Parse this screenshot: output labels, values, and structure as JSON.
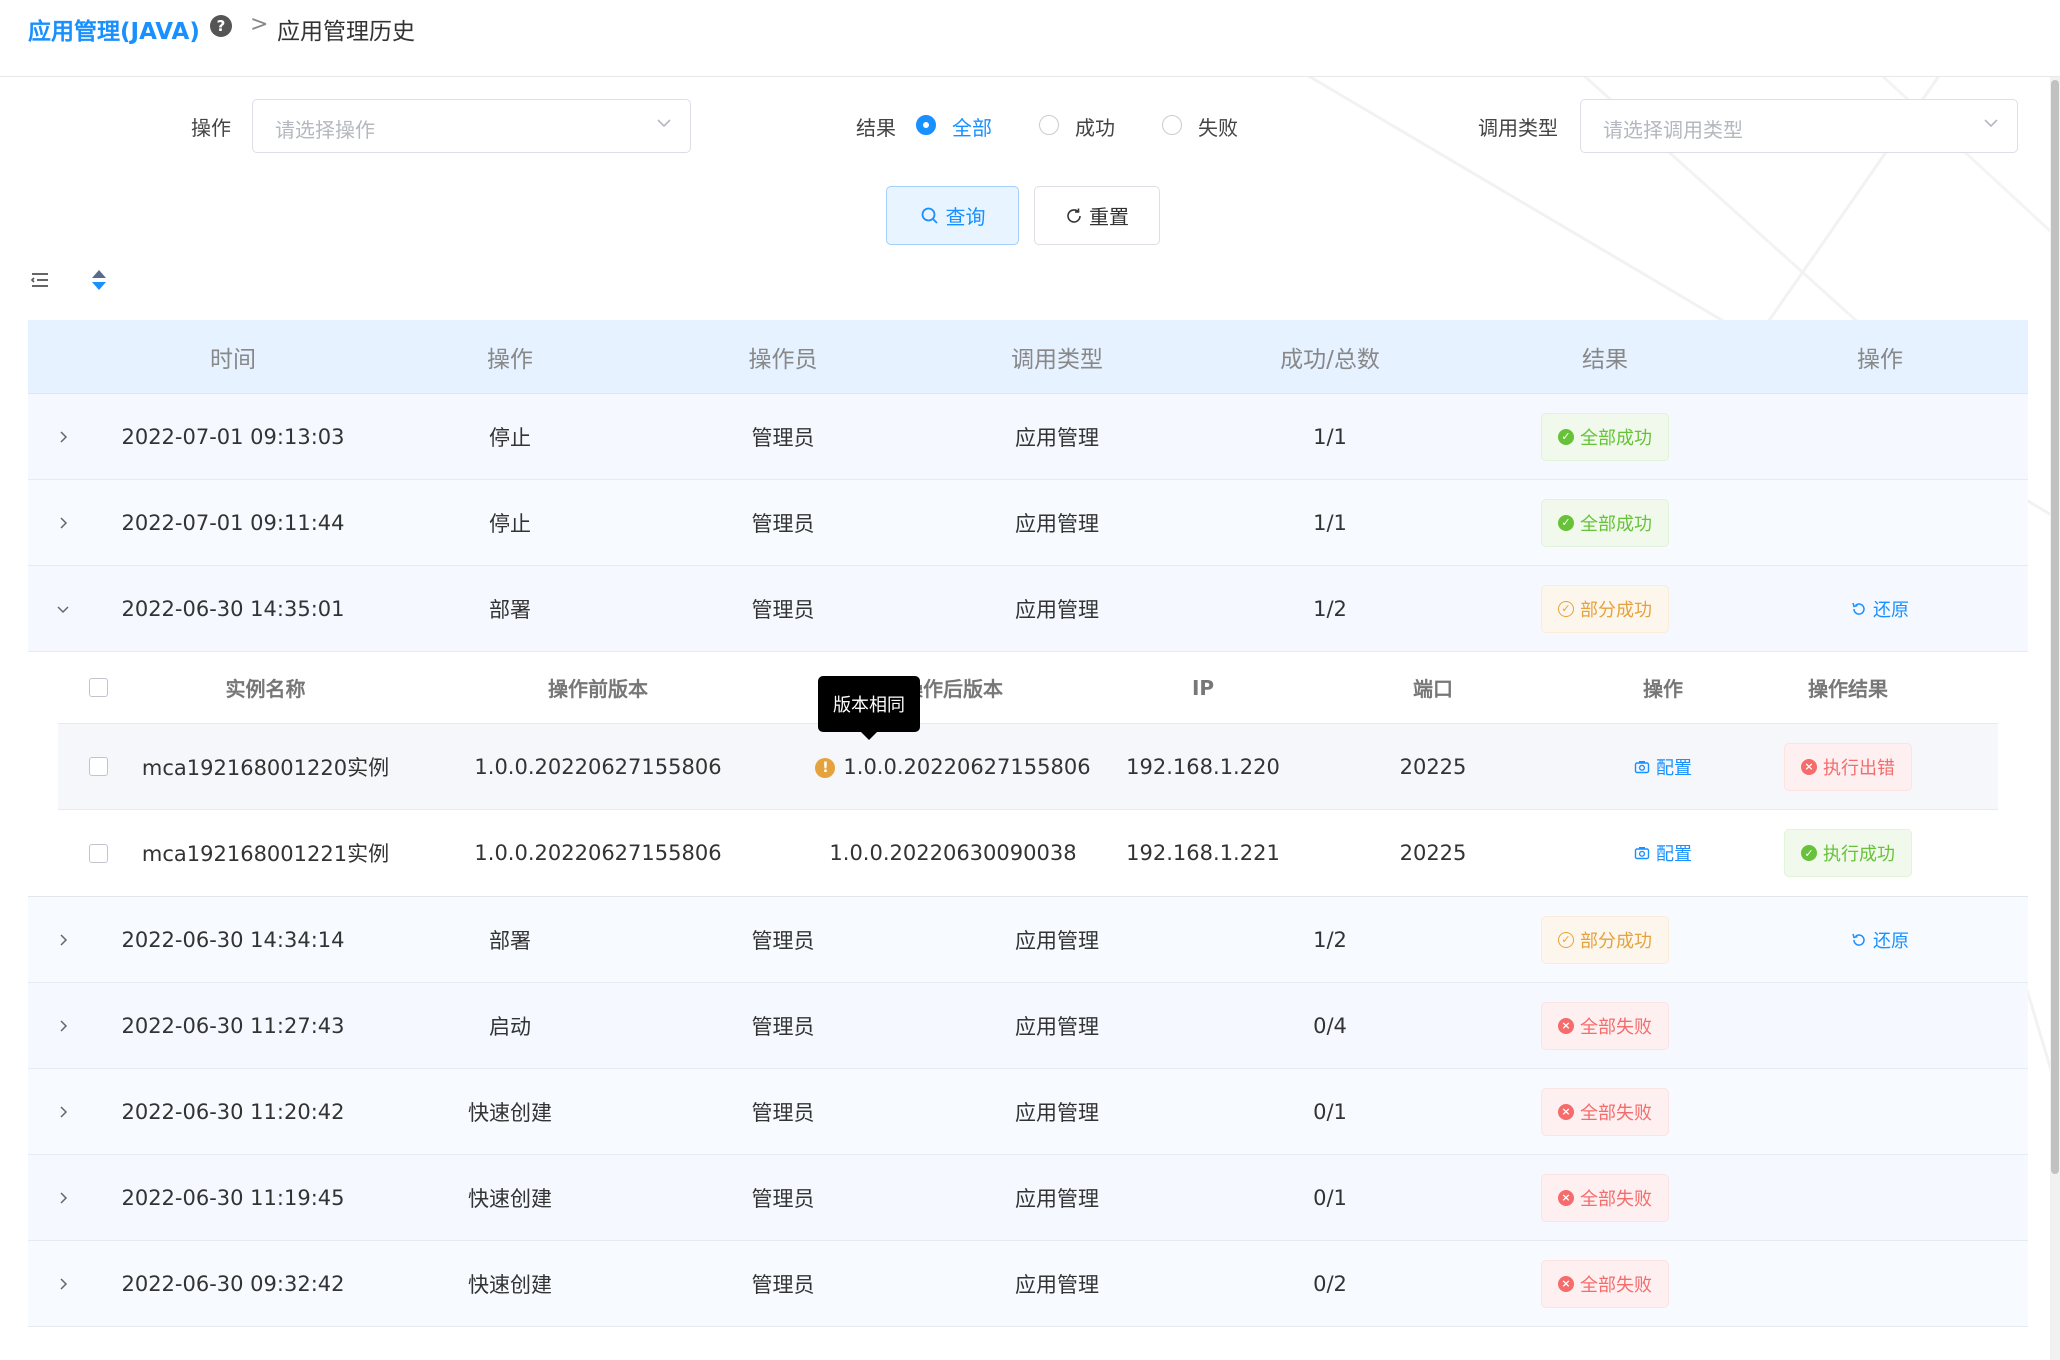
{
  "breadcrumb": {
    "app": "应用管理(JAVA)",
    "separator": ">",
    "page": "应用管理历史"
  },
  "filters": {
    "operation_label": "操作",
    "operation_placeholder": "请选择操作",
    "result_label": "结果",
    "result_options": [
      "全部",
      "成功",
      "失败"
    ],
    "result_selected": "全部",
    "call_type_label": "调用类型",
    "call_type_placeholder": "请选择调用类型",
    "query_label": "查询",
    "reset_label": "重置"
  },
  "table": {
    "headers": [
      "时间",
      "操作",
      "操作员",
      "调用类型",
      "成功/总数",
      "结果",
      "操作"
    ],
    "rows": [
      {
        "time": "2022-07-01 09:13:03",
        "op": "停止",
        "user": "管理员",
        "type": "应用管理",
        "ratio": "1/1",
        "result": "全部成功",
        "result_kind": "success",
        "action": ""
      },
      {
        "time": "2022-07-01 09:11:44",
        "op": "停止",
        "user": "管理员",
        "type": "应用管理",
        "ratio": "1/1",
        "result": "全部成功",
        "result_kind": "success",
        "action": ""
      },
      {
        "time": "2022-06-30 14:35:01",
        "op": "部署",
        "user": "管理员",
        "type": "应用管理",
        "ratio": "1/2",
        "result": "部分成功",
        "result_kind": "partial",
        "action": "还原"
      },
      {
        "time": "2022-06-30 14:34:14",
        "op": "部署",
        "user": "管理员",
        "type": "应用管理",
        "ratio": "1/2",
        "result": "部分成功",
        "result_kind": "partial",
        "action": "还原"
      },
      {
        "time": "2022-06-30 11:27:43",
        "op": "启动",
        "user": "管理员",
        "type": "应用管理",
        "ratio": "0/4",
        "result": "全部失败",
        "result_kind": "fail",
        "action": ""
      },
      {
        "time": "2022-06-30 11:20:42",
        "op": "快速创建",
        "user": "管理员",
        "type": "应用管理",
        "ratio": "0/1",
        "result": "全部失败",
        "result_kind": "fail",
        "action": ""
      },
      {
        "time": "2022-06-30 11:19:45",
        "op": "快速创建",
        "user": "管理员",
        "type": "应用管理",
        "ratio": "0/1",
        "result": "全部失败",
        "result_kind": "fail",
        "action": ""
      },
      {
        "time": "2022-06-30 09:32:42",
        "op": "快速创建",
        "user": "管理员",
        "type": "应用管理",
        "ratio": "0/2",
        "result": "全部失败",
        "result_kind": "fail",
        "action": ""
      }
    ],
    "expanded_row_index": 2
  },
  "nested": {
    "headers": [
      "实例名称",
      "操作前版本",
      "操作后版本",
      "IP",
      "端口",
      "操作",
      "操作结果"
    ],
    "rows": [
      {
        "name": "mca192168001220实例",
        "pre": "1.0.0.20220627155806",
        "post": "1.0.0.20220627155806",
        "ip": "192.168.1.220",
        "port": "20225",
        "action": "配置",
        "result": "执行出错",
        "result_kind": "fail",
        "warn": true
      },
      {
        "name": "mca192168001221实例",
        "pre": "1.0.0.20220627155806",
        "post": "1.0.0.20220630090038",
        "ip": "192.168.1.221",
        "port": "20225",
        "action": "配置",
        "result": "执行成功",
        "result_kind": "success",
        "warn": false
      }
    ],
    "tooltip": "版本相同"
  },
  "colors": {
    "primary": "#1890ff",
    "success": "#67c23a",
    "warning": "#e6a23c",
    "danger": "#f56c6c"
  }
}
